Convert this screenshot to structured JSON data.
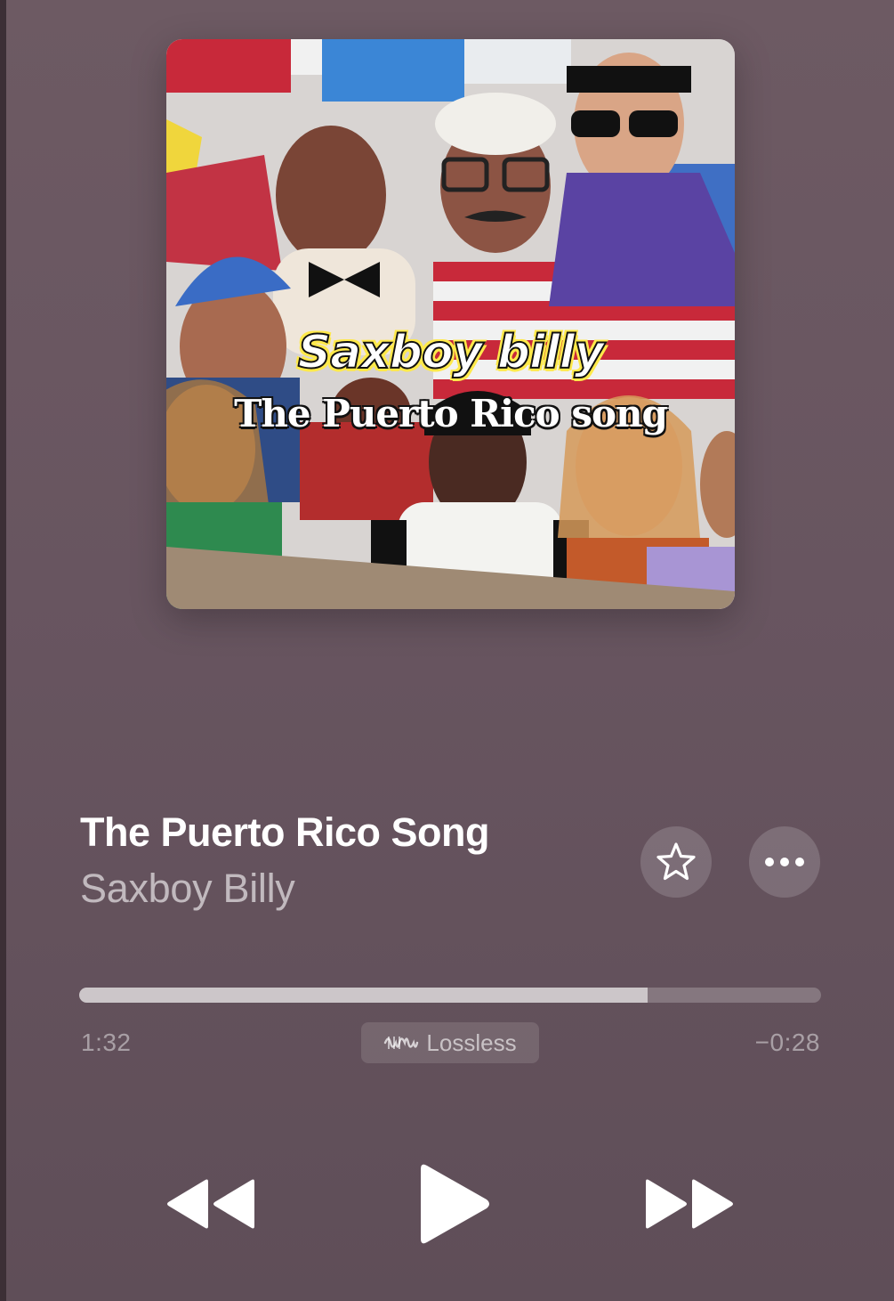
{
  "artwork": {
    "brand_text": "Saxboy billy",
    "title_text": "The Puerto Rico song"
  },
  "track": {
    "title": "The Puerto Rico Song",
    "artist": "Saxboy Billy"
  },
  "actions": {
    "favorite_icon": "star-icon",
    "more_icon": "ellipsis-icon"
  },
  "playback": {
    "elapsed": "1:32",
    "remaining": "−0:28",
    "progress_fraction": 0.7667,
    "quality_label": "Lossless",
    "quality_icon": "lossless-wave-icon"
  },
  "controls": {
    "previous_icon": "rewind-icon",
    "play_icon": "play-icon",
    "next_icon": "fast-forward-icon"
  }
}
